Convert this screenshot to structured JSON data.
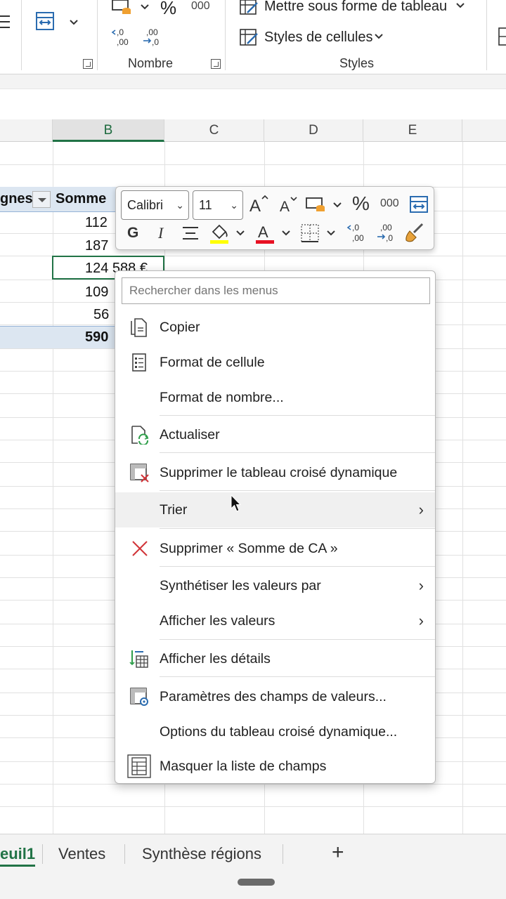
{
  "ribbon": {
    "wrap_button_icon": "wrap-text-icon",
    "number_group_label": "Nombre",
    "percent_symbol": "%",
    "thousands_symbol": "000",
    "format_as_table_label": "Mettre sous forme de tableau",
    "cell_styles_label": "Styles de cellules",
    "styles_group_label": "Styles"
  },
  "columns": [
    {
      "label": "B",
      "selected": true
    },
    {
      "label": "C",
      "selected": false
    },
    {
      "label": "D",
      "selected": false
    },
    {
      "label": "E",
      "selected": false
    }
  ],
  "pivot": {
    "row_header": "gnes",
    "value_header": "Somme",
    "values": [
      "112",
      "187",
      "124 588 €",
      "109",
      "56"
    ],
    "total": "590"
  },
  "mini_toolbar": {
    "font_name": "Calibri",
    "font_size": "11",
    "bold_label": "G",
    "italic_label": "I",
    "percent_label": "%",
    "thousands_label": "000",
    "fill_color": "#ffff00",
    "font_color": "#e81123"
  },
  "context_menu": {
    "search_placeholder": "Rechercher dans les menus",
    "items": [
      {
        "label": "Copier",
        "icon": "copy-icon"
      },
      {
        "label": "Format de cellule",
        "icon": "format-cells-icon"
      },
      {
        "label": "Format de nombre...",
        "icon": ""
      },
      {
        "label": "Actualiser",
        "icon": "refresh-icon"
      },
      {
        "label": "Supprimer le tableau croisé dynamique",
        "icon": "delete-pivot-icon"
      },
      {
        "label": "Trier",
        "icon": "",
        "submenu": true
      },
      {
        "label": "Supprimer « Somme de CA »",
        "icon": "remove-x-icon"
      },
      {
        "label": "Synthétiser les valeurs par",
        "icon": "",
        "submenu": true
      },
      {
        "label": "Afficher les valeurs",
        "icon": "",
        "submenu": true
      },
      {
        "label": "Afficher les détails",
        "icon": "show-details-icon"
      },
      {
        "label": "Paramètres des champs de valeurs...",
        "icon": "field-settings-icon"
      },
      {
        "label": "Options du tableau croisé dynamique...",
        "icon": ""
      },
      {
        "label": "Masquer la liste de champs",
        "icon": "field-list-icon"
      }
    ]
  },
  "sheet_tabs": {
    "tabs": [
      {
        "label": "euil1",
        "active": true
      },
      {
        "label": "Ventes",
        "active": false
      },
      {
        "label": "Synthèse régions",
        "active": false
      }
    ],
    "add_label": "+"
  }
}
